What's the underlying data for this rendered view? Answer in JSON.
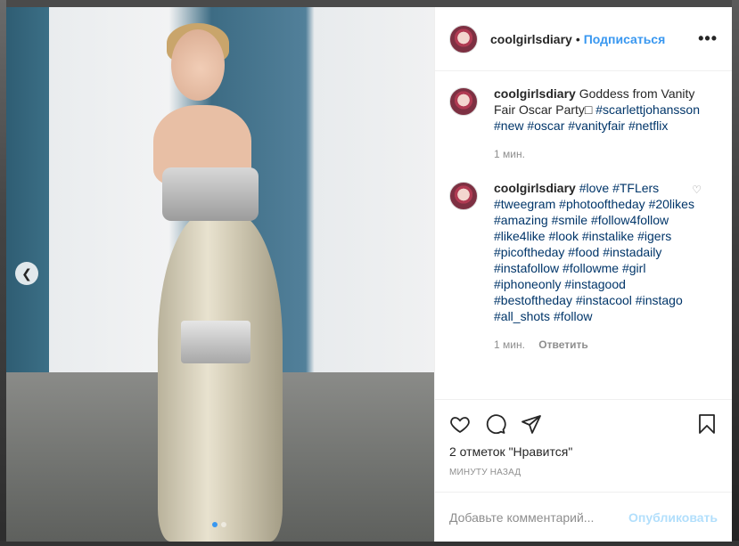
{
  "header": {
    "username": "coolgirlsdiary",
    "separator": "•",
    "follow_label": "Подписаться",
    "more_label": "•••"
  },
  "caption": {
    "username": "coolgirlsdiary",
    "text": "Goddess from Vanity Fair Oscar Party□ ",
    "tags": [
      "#scarlettjohansson",
      "#new",
      "#oscar",
      "#vanityfair",
      "#netflix"
    ],
    "time": "1 мин."
  },
  "comment": {
    "username": "coolgirlsdiary",
    "tags": [
      "#love",
      "#TFLers",
      "#tweegram",
      "#photooftheday",
      "#20likes",
      "#amazing",
      "#smile",
      "#follow4follow",
      "#like4like",
      "#look",
      "#instalike",
      "#igers",
      "#picoftheday",
      "#food",
      "#instadaily",
      "#instafollow",
      "#followme",
      "#girl",
      "#iphoneonly",
      "#instagood",
      "#bestoftheday",
      "#instacool",
      "#instago",
      "#all_shots",
      "#follow"
    ],
    "time": "1 мин.",
    "reply_label": "Ответить"
  },
  "likes_text": "2 отметок \"Нравится\"",
  "timestamp": "МИНУТУ НАЗАД",
  "add_comment": {
    "placeholder": "Добавьте комментарий...",
    "post_label": "Опубликовать"
  },
  "carousel": {
    "prev_icon": "chevron-left-icon",
    "slide_count": 2,
    "active_index": 1
  },
  "colors": {
    "accent": "#3897f0",
    "post_disabled": "#b2dffc",
    "hashtag": "#003569"
  }
}
